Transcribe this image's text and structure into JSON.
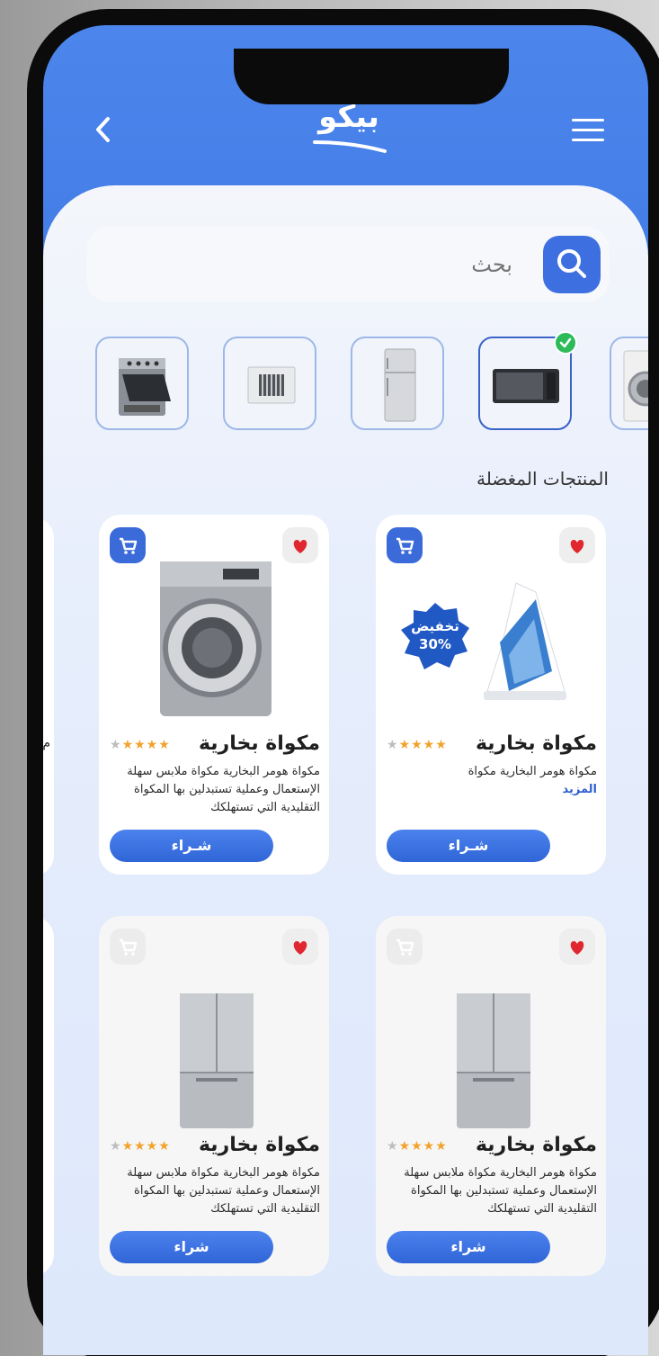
{
  "header": {
    "brand": "بيكو",
    "back_icon": "chevron-left-icon",
    "menu_icon": "hamburger-menu-icon"
  },
  "search": {
    "placeholder": "بحث",
    "icon": "search-icon"
  },
  "categories": [
    {
      "name": "washing-machine",
      "icon": "washing-machine-icon",
      "selected": false
    },
    {
      "name": "microwave",
      "icon": "microwave-icon",
      "selected": true
    },
    {
      "name": "refrigerator",
      "icon": "refrigerator-icon",
      "selected": false
    },
    {
      "name": "air-conditioner",
      "icon": "air-conditioner-icon",
      "selected": false
    },
    {
      "name": "stove",
      "icon": "stove-icon",
      "selected": false
    }
  ],
  "section_title": "المنتجات المغضلة",
  "products": [
    {
      "title": "مكواة بخارية",
      "description": "مكواة هومر البخارية مكواة",
      "more": "المزيد",
      "buy_label": "شـراء",
      "discount": "تخفيض 30%",
      "rating": 4,
      "image": "steam-iron",
      "cart_active": true
    },
    {
      "title": "مكواة بخارية",
      "description": "مكواة هومر البخارية مكواة ملابس سهلة الإستعمال وعملية تستبدلين بها المكواة التقليدية التي تستهلكك",
      "buy_label": "شـراء",
      "rating": 4,
      "image": "washing-machine",
      "cart_active": true
    },
    {
      "title": "مكواة بخارية",
      "description": "مكواة هومر البخارية مكواة ملابس سهلة الإستعمال وعملية تستبدلين بها المكواة التقليدية التي تستهلكك",
      "buy_label": "شراء",
      "rating": 4,
      "image": "refrigerator",
      "cart_active": false
    },
    {
      "title": "مكواة بخارية",
      "description": "مكواة هومر البخارية مكواة ملابس سهلة الإستعمال وعملية تستبدلين بها المكواة التقليدية التي تستهلكك",
      "buy_label": "شراء",
      "rating": 4,
      "image": "refrigerator",
      "cart_active": false
    }
  ],
  "colors": {
    "primary": "#3d6fe0",
    "header_bg": "#4c86ec",
    "favorite": "#e0262f",
    "star": "#f2a22b",
    "check": "#2dbb5a"
  }
}
